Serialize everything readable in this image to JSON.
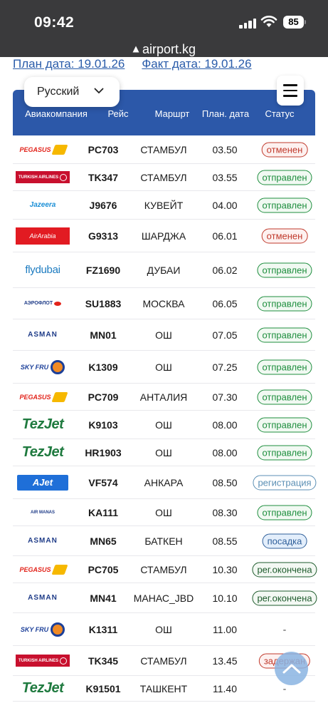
{
  "status_bar": {
    "time": "09:42",
    "battery": "85"
  },
  "browser": {
    "url": "airport.kg"
  },
  "dates": {
    "plan": "План дата: 19.01.26",
    "fact": "Факт дата: 19.01.26"
  },
  "language": {
    "selected": "Русский"
  },
  "table": {
    "headers": [
      "Авиакомпания",
      "Рейс",
      "Маршрт",
      "План. дата",
      "Статус"
    ],
    "rows": [
      {
        "logo": "PEGASUS",
        "flight": "PC703",
        "route": "СТАМБУЛ",
        "time": "03.50",
        "status": "отменен",
        "kind": "cancel"
      },
      {
        "logo": "TURKISH AIRLINES",
        "flight": "TK347",
        "route": "СТАМБУЛ",
        "time": "03.55",
        "status": "отправлен",
        "kind": "sent"
      },
      {
        "logo": "Jazeera",
        "flight": "J9676",
        "route": "КУВЕЙТ",
        "time": "04.00",
        "status": "отправлен",
        "kind": "sent"
      },
      {
        "logo": "AirArabia",
        "flight": "G9313",
        "route": "ШАРДЖА",
        "time": "06.01",
        "status": "отменен",
        "kind": "cancel"
      },
      {
        "logo": "flydubai",
        "flight": "FZ1690",
        "route": "ДУБАИ",
        "time": "06.02",
        "status": "отправлен",
        "kind": "sent"
      },
      {
        "logo": "АЭРОФЛОТ",
        "flight": "SU1883",
        "route": "МОСКВА",
        "time": "06.05",
        "status": "отправлен",
        "kind": "sent"
      },
      {
        "logo": "ASMAN",
        "flight": "MN01",
        "route": "ОШ",
        "time": "07.05",
        "status": "отправлен",
        "kind": "sent"
      },
      {
        "logo": "SKY FRU",
        "flight": "K1309",
        "route": "ОШ",
        "time": "07.25",
        "status": "отправлен",
        "kind": "sent"
      },
      {
        "logo": "PEGASUS",
        "flight": "PC709",
        "route": "АНТАЛИЯ",
        "time": "07.30",
        "status": "отправлен",
        "kind": "sent"
      },
      {
        "logo": "TezJet",
        "flight": "K9103",
        "route": "ОШ",
        "time": "08.00",
        "status": "отправлен",
        "kind": "sent"
      },
      {
        "logo": "TezJet",
        "flight": "HR1903",
        "route": "ОШ",
        "time": "08.00",
        "status": "отправлен",
        "kind": "sent"
      },
      {
        "logo": "AJet",
        "flight": "VF574",
        "route": "АНКАРА",
        "time": "08.50",
        "status": "регистрация",
        "kind": "reg"
      },
      {
        "logo": "AIR MANAS",
        "flight": "KA111",
        "route": "ОШ",
        "time": "08.30",
        "status": "отправлен",
        "kind": "sent"
      },
      {
        "logo": "ASMAN",
        "flight": "MN65",
        "route": "БАТКЕН",
        "time": "08.55",
        "status": "посадка",
        "kind": "board"
      },
      {
        "logo": "PEGASUS",
        "flight": "PC705",
        "route": "СТАМБУЛ",
        "time": "10.30",
        "status": "рег.окончена",
        "kind": "end"
      },
      {
        "logo": "ASMAN",
        "flight": "MN41",
        "route": "МАНАС_JBD",
        "time": "10.10",
        "status": "рег.окончена",
        "kind": "end"
      },
      {
        "logo": "SKY FRU",
        "flight": "K1311",
        "route": "ОШ",
        "time": "11.00",
        "status": "-",
        "kind": "none"
      },
      {
        "logo": "TURKISH AIRLINES",
        "flight": "TK345",
        "route": "СТАМБУЛ",
        "time": "13.45",
        "status": "задержан",
        "kind": "delay"
      },
      {
        "logo": "TezJet",
        "flight": "K91501",
        "route": "ТАШКЕНТ",
        "time": "11.40",
        "status": "-",
        "kind": "none"
      }
    ]
  }
}
